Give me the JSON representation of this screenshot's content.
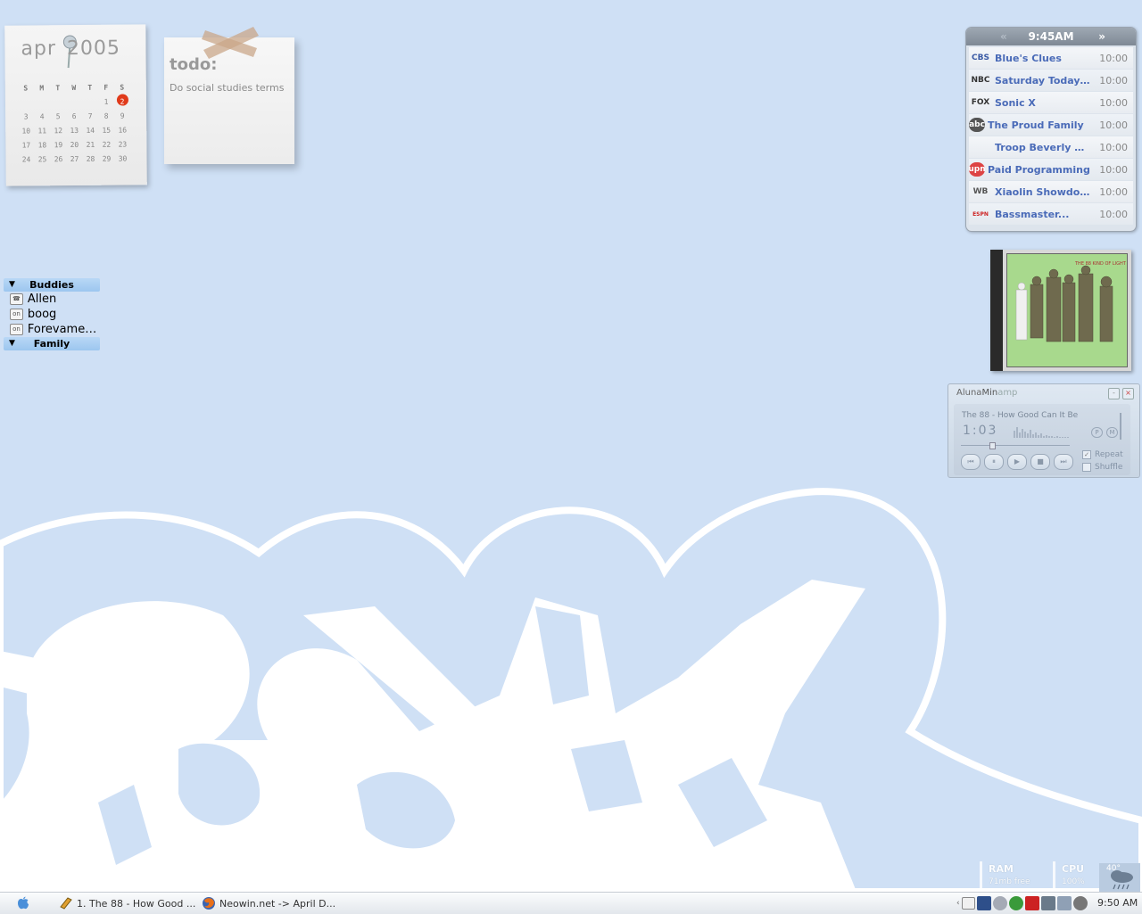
{
  "calendar": {
    "month": "apr",
    "year": "2005",
    "weekdays": [
      "S",
      "M",
      "T",
      "W",
      "T",
      "F",
      "S"
    ],
    "weeks": [
      [
        "",
        "",
        "",
        "",
        "",
        "1",
        "2"
      ],
      [
        "3",
        "4",
        "5",
        "6",
        "7",
        "8",
        "9"
      ],
      [
        "10",
        "11",
        "12",
        "13",
        "14",
        "15",
        "16"
      ],
      [
        "17",
        "18",
        "19",
        "20",
        "21",
        "22",
        "23"
      ],
      [
        "24",
        "25",
        "26",
        "27",
        "28",
        "29",
        "30"
      ]
    ],
    "today": "2",
    "today_color": "#e03a1a"
  },
  "todo": {
    "title": "todo:",
    "text": "Do social studies terms"
  },
  "buddies": {
    "groups": [
      {
        "label": "Buddies",
        "members": [
          {
            "name": "Allen",
            "status": "phone"
          },
          {
            "name": "boog",
            "status": "on"
          },
          {
            "name": "Forevame7...",
            "status": "on"
          }
        ]
      },
      {
        "label": "Family",
        "members": []
      }
    ]
  },
  "tv": {
    "time": "9:45AM",
    "prev_icon": "double-chevron-left-icon",
    "next_icon": "double-chevron-right-icon",
    "listings": [
      {
        "channel": "CBS",
        "logo": "cbs-eye-logo",
        "show": "Blue's Clues",
        "time": "10:00"
      },
      {
        "channel": "NBC",
        "logo": "nbc-peacock-logo",
        "show": "Saturday Today in...",
        "time": "10:00"
      },
      {
        "channel": "FOX",
        "logo": "fox-logo",
        "show": "Sonic X",
        "time": "10:00"
      },
      {
        "channel": "abc",
        "logo": "abc-logo",
        "show": "The Proud Family",
        "time": "10:00"
      },
      {
        "channel": "",
        "logo": "channel-logo",
        "show": "Troop Beverly Hills...",
        "time": "10:00"
      },
      {
        "channel": "upn",
        "logo": "upn-logo",
        "show": "Paid Programming",
        "time": "10:00"
      },
      {
        "channel": "WB",
        "logo": "wb-logo",
        "show": "Xiaolin Showdown",
        "time": "10:00"
      },
      {
        "channel": "ESPN",
        "logo": "espn-logo",
        "show": "Bassmaster...",
        "time": "10:00"
      }
    ]
  },
  "album": {
    "cover_text": "THE 88   KIND OF LIGHT",
    "cover_color": "#a8d98d"
  },
  "amp": {
    "title_dark": "Aluna",
    "title_mid": "Min",
    "title_light": "amp",
    "track": "The 88 - How Good Can It Be",
    "time": "1:03",
    "progress": 0.26,
    "p_label": "P",
    "m_label": "M",
    "repeat_label": "Repeat",
    "repeat_checked": true,
    "shuffle_label": "Shuffle",
    "shuffle_checked": false,
    "minimize_label": "-",
    "close_label": "×"
  },
  "meters": {
    "ram_label": "RAM",
    "ram_value": "71mb free",
    "cpu_label": "CPU",
    "cpu_value": "100%",
    "weather_temp": "40°",
    "weather_icon": "rain-cloud-icon"
  },
  "taskbar": {
    "start_icon": "apple-icon",
    "tasks": [
      {
        "label": "1. The 88 - How Good ...",
        "icon": "winamp-icon"
      },
      {
        "label": "Neowin.net -> April D...",
        "icon": "firefox-icon"
      }
    ],
    "tray_icons": [
      "tray-expand-icon",
      "aim-icon",
      "network-icon",
      "volume-icon",
      "globe-icon",
      "kaspersky-icon",
      "printer-icon",
      "drive-icon",
      "settings-icon",
      "tray-app-icon"
    ],
    "clock": "9:50 AM"
  },
  "colors": {
    "desktop": "#cfe0f5",
    "wallpaper_art": "#ffffff",
    "tv_show_link": "#4a6bb8"
  }
}
